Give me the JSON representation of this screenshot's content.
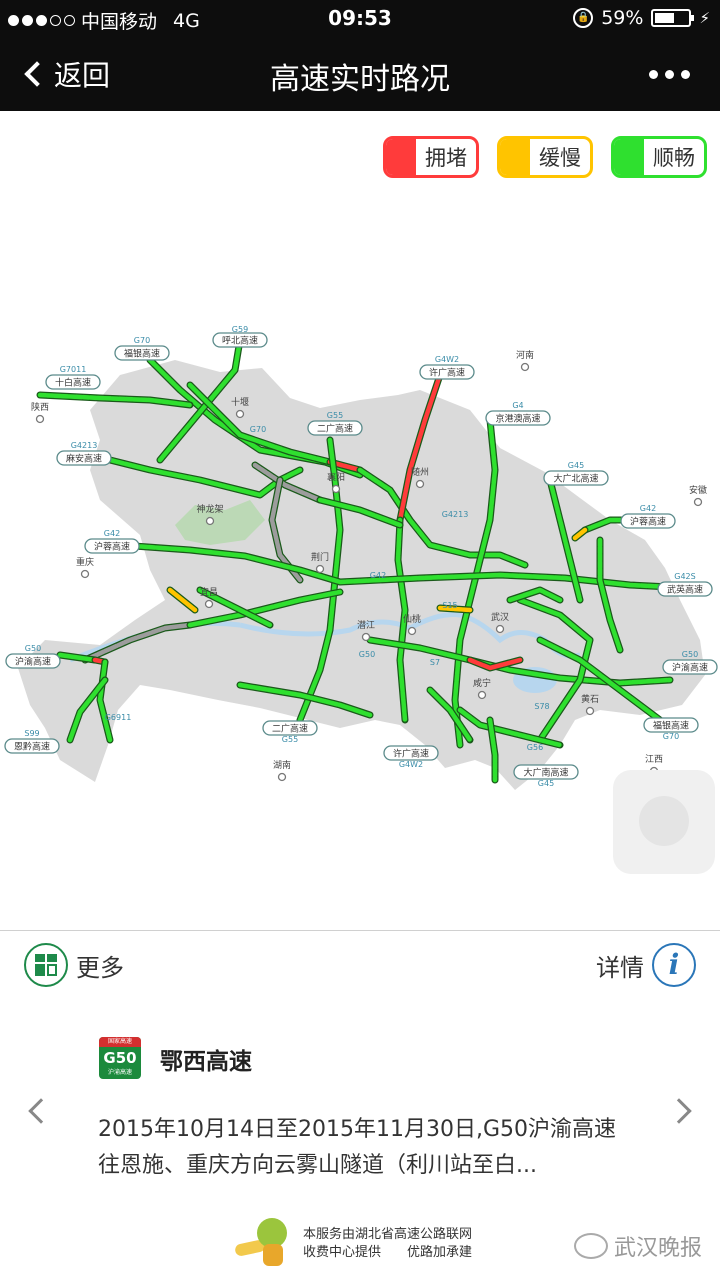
{
  "status_bar": {
    "carrier": "中国移动",
    "network": "4G",
    "time": "09:53",
    "battery": "59%",
    "battery_level": 0.59
  },
  "nav": {
    "back_label": "返回",
    "title": "高速实时路况"
  },
  "legend": [
    {
      "label": "拥堵",
      "color": "#ff3b3b"
    },
    {
      "label": "缓慢",
      "color": "#ffc400"
    },
    {
      "label": "顺畅",
      "color": "#2fe02f"
    }
  ],
  "map": {
    "highway_labels": [
      {
        "code": "G59",
        "name": "呼北高速"
      },
      {
        "code": "G70",
        "name": "福银高速"
      },
      {
        "code": "G7011",
        "name": "十白高速"
      },
      {
        "code": "G4W2",
        "name": "许广高速"
      },
      {
        "code": "G55",
        "name": "二广高速"
      },
      {
        "code": "G4",
        "name": "京港澳高速"
      },
      {
        "code": "G4213",
        "name": "麻安高速"
      },
      {
        "code": "G45",
        "name": "大广北高速"
      },
      {
        "code": "G42",
        "name": "沪蓉高速"
      },
      {
        "code": "G42",
        "name": "沪蓉高速"
      },
      {
        "code": "G42S",
        "name": "武英高速"
      },
      {
        "code": "G50",
        "name": "沪渝高速"
      },
      {
        "code": "G50",
        "name": "沪渝高速"
      },
      {
        "code": "G70",
        "name": "福银高速"
      },
      {
        "code": "S99",
        "name": "恩黔高速"
      },
      {
        "code": "G55",
        "name": "二广高速"
      },
      {
        "code": "G4W2",
        "name": "许广高速"
      },
      {
        "code": "G45",
        "name": "大广南高速"
      }
    ],
    "cities": [
      "陕西",
      "十堰",
      "河南",
      "襄阳",
      "随州",
      "神龙架",
      "安徽",
      "重庆",
      "荆门",
      "宜昌",
      "潜江",
      "仙桃",
      "武汉",
      "咸宁",
      "黄石",
      "湖南",
      "江西"
    ],
    "route_codes": [
      "G70",
      "G42",
      "S15",
      "G50",
      "S7",
      "S78",
      "G56",
      "G4213",
      "G6911"
    ]
  },
  "actions": {
    "more_label": "更多",
    "detail_label": "详情"
  },
  "notice": {
    "shield_top": "国家高速",
    "shield_code": "G50",
    "shield_bottom": "沪渝高速",
    "title": "鄂西高速",
    "body": "2015年10月14日至2015年11月30日,G50沪渝高速往恩施、重庆方向云雾山隧道（利川站至白..."
  },
  "footer": {
    "line1": "本服务由湖北省高速公路联网",
    "line2": "收费中心提供　　优路加承建",
    "watermark": "武汉晚报"
  }
}
